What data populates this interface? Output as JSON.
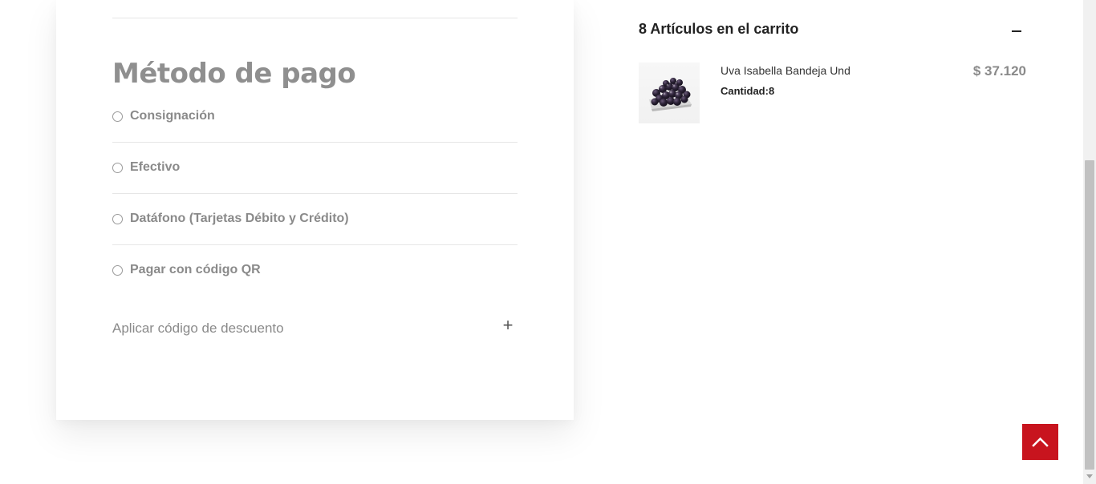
{
  "payment": {
    "title": "Método de pago",
    "options": [
      {
        "label": "Consignación"
      },
      {
        "label": "Efectivo"
      },
      {
        "label": "Datáfono (Tarjetas Débito y Crédito)"
      },
      {
        "label": "Pagar con código QR"
      }
    ],
    "discount_label": "Aplicar código de descuento",
    "discount_toggle": "+"
  },
  "cart": {
    "header": "8 Artículos en el carrito",
    "items": [
      {
        "name": "Uva Isabella Bandeja Und",
        "quantity": "Cantidad:8",
        "price": "$ 37.120"
      }
    ]
  },
  "colors": {
    "accent": "#c8141e",
    "muted_text": "#8a8a8a",
    "divider": "#e6e6e6"
  },
  "icons": {
    "collapse": "minus-icon",
    "expand": "plus-icon",
    "back_to_top": "chevron-up-icon"
  }
}
